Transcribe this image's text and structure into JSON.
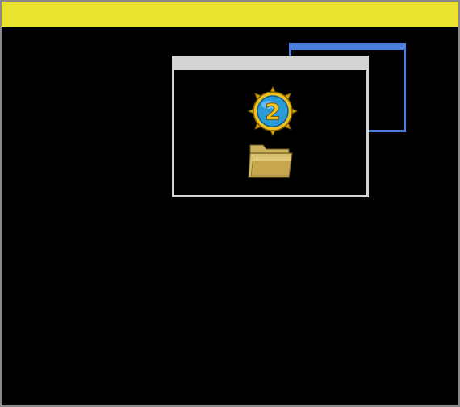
{
  "screen": {
    "top_bar_color": "#e9e22e",
    "background_color": "#000000",
    "border_color": "#8a8a8a"
  },
  "windows": [
    {
      "id": "back-window",
      "border_color": "#4a7fe0"
    },
    {
      "id": "front-window",
      "border_color": "#d4d4d4",
      "icons": [
        {
          "name": "badge-icon",
          "label": "2"
        },
        {
          "name": "folder-icon"
        }
      ]
    }
  ]
}
